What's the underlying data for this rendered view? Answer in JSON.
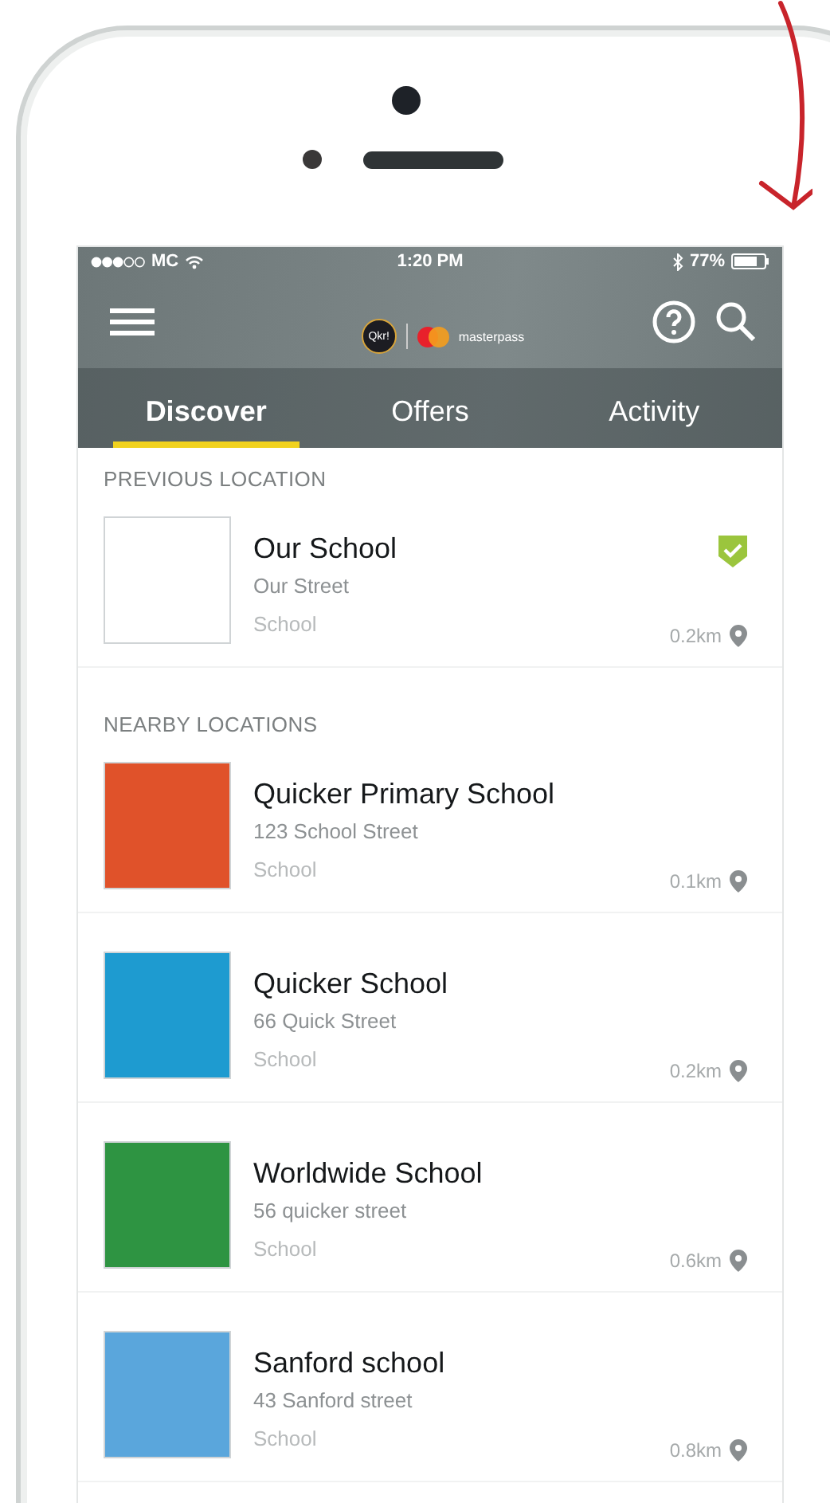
{
  "status_bar": {
    "carrier": "MC",
    "time": "1:20 PM",
    "battery": "77%"
  },
  "header": {
    "logo_text": "Qkr!",
    "partner_text": "masterpass"
  },
  "tabs": [
    {
      "label": "Discover",
      "selected": true
    },
    {
      "label": "Offers",
      "selected": false
    },
    {
      "label": "Activity",
      "selected": false
    }
  ],
  "sections": [
    {
      "title": "PREVIOUS LOCATION",
      "locations": [
        {
          "name": "Our School",
          "address": "Our Street",
          "type": "School",
          "distance": "0.2km",
          "verified": true,
          "color": "#ffffff"
        }
      ]
    },
    {
      "title": "NEARBY LOCATIONS",
      "locations": [
        {
          "name": "Quicker Primary School",
          "address": "123 School Street",
          "type": "School",
          "distance": "0.1km",
          "verified": false,
          "color": "#e0522a"
        },
        {
          "name": "Quicker School",
          "address": "66 Quick Street",
          "type": "School",
          "distance": "0.2km",
          "verified": false,
          "color": "#1e9bd0"
        },
        {
          "name": "Worldwide School",
          "address": "56 quicker street",
          "type": "School",
          "distance": "0.6km",
          "verified": false,
          "color": "#2e9442"
        },
        {
          "name": "Sanford school",
          "address": "43 Sanford street",
          "type": "School",
          "distance": "0.8km",
          "verified": false,
          "color": "#5aa6dc"
        }
      ]
    }
  ]
}
